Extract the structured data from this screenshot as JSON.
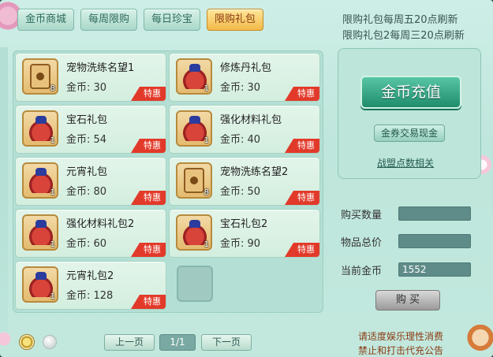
{
  "tabs": [
    {
      "label": "金币商城",
      "active": false
    },
    {
      "label": "每周限购",
      "active": false
    },
    {
      "label": "每日珍宝",
      "active": false
    },
    {
      "label": "限购礼包",
      "active": true
    }
  ],
  "notice": {
    "line1": "限购礼包每周五20点刷新",
    "line2": "限购礼包2每周三20点刷新"
  },
  "items": [
    {
      "name": "宠物洗练名望1",
      "price": "金币: 30",
      "qty": "8",
      "tag": "特惠",
      "icon": "pet-scroll-icon"
    },
    {
      "name": "修炼丹礼包",
      "price": "金币: 30",
      "qty": "1",
      "tag": "特惠",
      "icon": "gift-bag-icon"
    },
    {
      "name": "宝石礼包",
      "price": "金币: 54",
      "qty": "1",
      "tag": "特惠",
      "icon": "gift-bag-icon"
    },
    {
      "name": "强化材料礼包",
      "price": "金币: 40",
      "qty": "1",
      "tag": "特惠",
      "icon": "gift-bag-icon"
    },
    {
      "name": "元宵礼包",
      "price": "金币: 80",
      "qty": "1",
      "tag": "特惠",
      "icon": "gift-bag-icon"
    },
    {
      "name": "宠物洗练名望2",
      "price": "金币: 50",
      "qty": "8",
      "tag": "特惠",
      "icon": "pet-scroll-icon"
    },
    {
      "name": "强化材料礼包2",
      "price": "金币: 60",
      "qty": "1",
      "tag": "特惠",
      "icon": "gift-bag-icon"
    },
    {
      "name": "宝石礼包2",
      "price": "金币: 90",
      "qty": "1",
      "tag": "特惠",
      "icon": "gift-bag-icon"
    },
    {
      "name": "元宵礼包2",
      "price": "金币: 128",
      "qty": "1",
      "tag": "特惠",
      "icon": "gift-bag-icon"
    }
  ],
  "right": {
    "recharge_label": "金币充值",
    "coupon_label": "金券交易现金",
    "alliance_label": "战盟点数相关",
    "qty_label": "购买数量",
    "total_label": "物品总价",
    "gold_label": "当前金币",
    "gold_value": "1552",
    "buy_label": "购 买"
  },
  "pagination": {
    "prev": "上一页",
    "page": "1/1",
    "next": "下一页"
  },
  "footer": {
    "line1": "请适度娱乐理性消费",
    "line2": "禁止和打击代充公告"
  }
}
